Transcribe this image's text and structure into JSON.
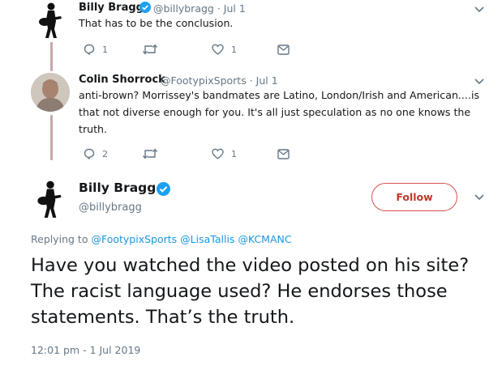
{
  "tweet1": {
    "name": "Billy Bragg",
    "handle_date": "@billybragg · Jul 1",
    "text": "That has to be the conclusion.",
    "reply_count": "1",
    "like_count": "1",
    "avatar_icon": "guitarist-silhouette-icon"
  },
  "tweet2": {
    "name": "Colin Shorrock",
    "handle_date": "@FootypixSports · Jul 1",
    "text_line1": "anti-brown? Morrissey's bandmates are Latino, London/Irish and American....is",
    "text_line2": "that not diverse enough for you. It's all just speculation as no one knows the",
    "text_line3": "truth.",
    "reply_count": "2",
    "like_count": "1"
  },
  "main_tweet": {
    "name": "Billy Bragg",
    "handle": "@billybragg",
    "follow_label": "Follow",
    "replying_to_label": "Replying to",
    "replying_to": [
      "@FootypixSports",
      "@LisaTallis",
      "@KCMANC"
    ],
    "text": "Have you watched the video posted on his site? The racist language used? He endorses those statements. That’s the truth.",
    "timestamp": "12:01 pm - 1 Jul 2019"
  },
  "colors": {
    "verified": "#1da1f2",
    "link": "#1b95e0",
    "follow_border": "#d9534f",
    "muted": "#657786",
    "thread_line": "#c8a8a8"
  }
}
